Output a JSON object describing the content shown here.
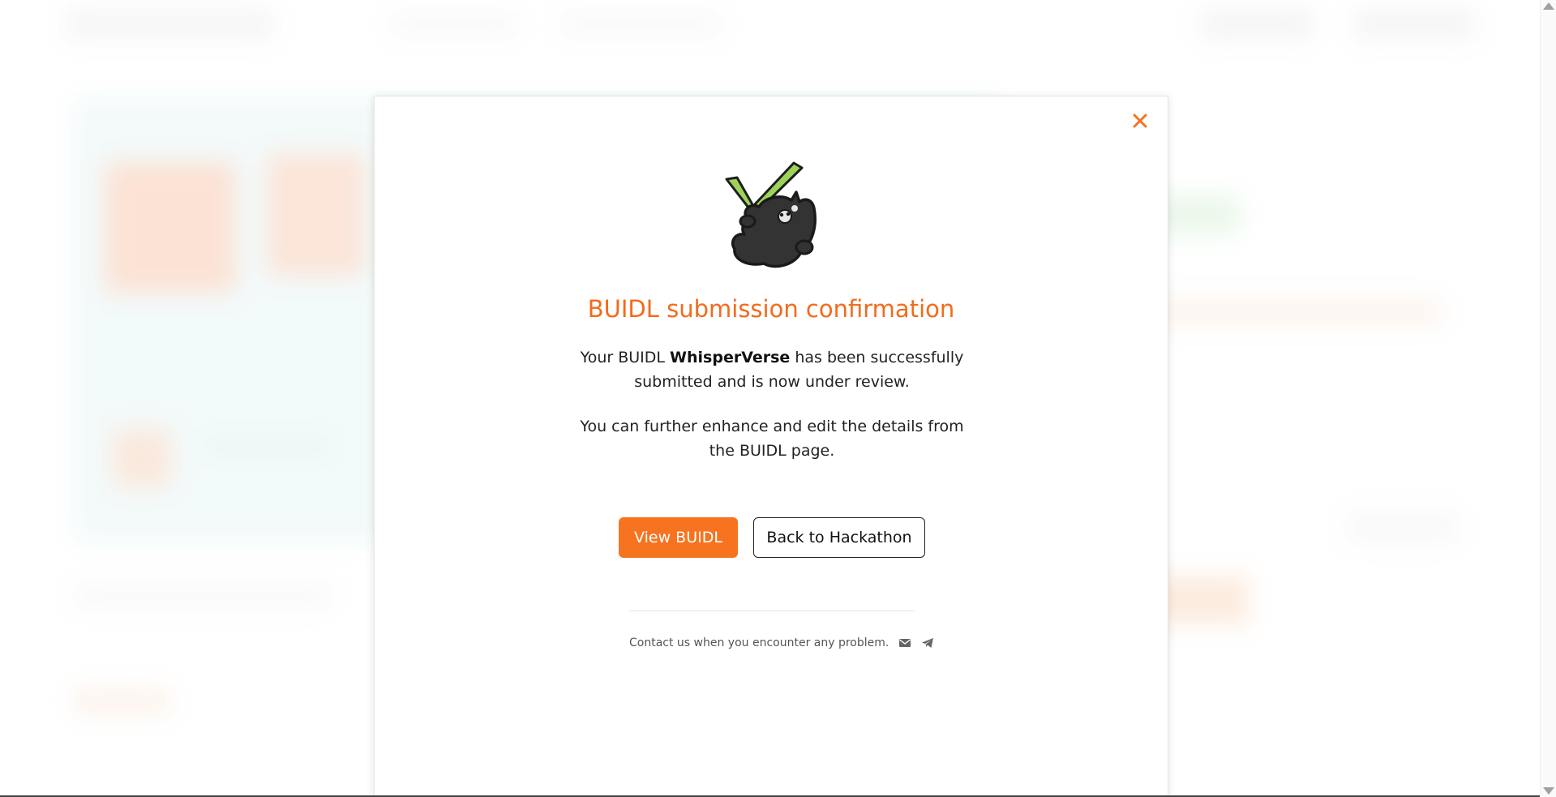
{
  "modal": {
    "title": "BUIDL submission confirmation",
    "message1_prefix": "Your BUIDL ",
    "buidl_name": "WhisperVerse",
    "message1_suffix": " has been successfully submitted and is now under review.",
    "message2": "You can further enhance and edit the details from the BUIDL page.",
    "primary_button": "View BUIDL",
    "secondary_button": "Back to Hackathon",
    "contact_text": "Contact us when you encounter any problem.",
    "icons": {
      "close": "close-icon",
      "email": "email-icon",
      "telegram": "telegram-icon",
      "illustration": "cat-checkmark-illustration"
    }
  },
  "colors": {
    "accent": "#f7731f",
    "title": "#f36b1c",
    "check_green": "#9ed35a"
  }
}
